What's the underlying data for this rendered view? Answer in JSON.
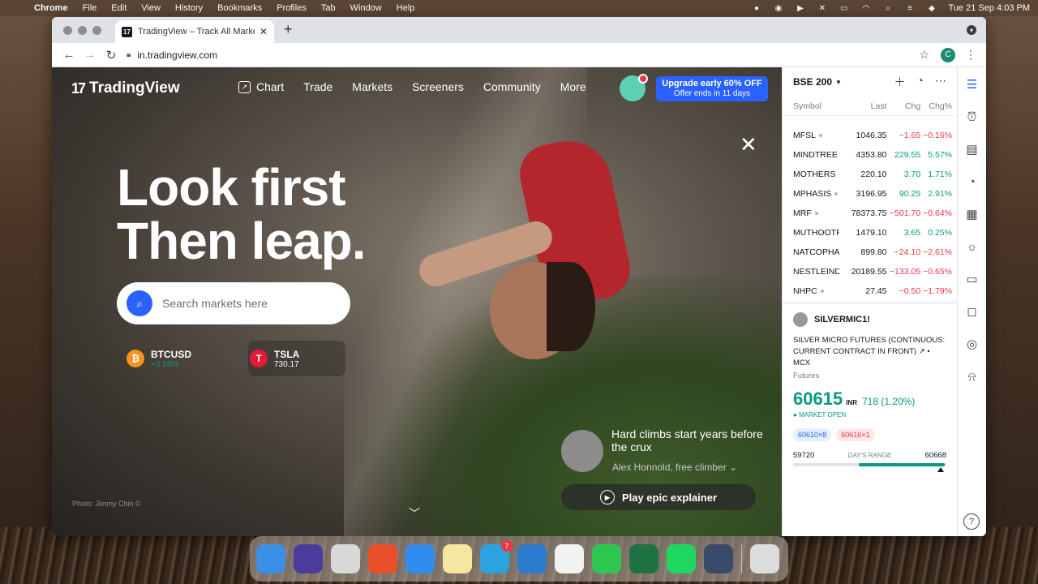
{
  "menubar": {
    "app": "Chrome",
    "items": [
      "File",
      "Edit",
      "View",
      "History",
      "Bookmarks",
      "Profiles",
      "Tab",
      "Window",
      "Help"
    ],
    "datetime": "Tue 21 Sep  4:03 PM",
    "notification_badge": "7"
  },
  "browser": {
    "tab_title": "TradingView – Track All Markets",
    "tab_favicon": "17",
    "url": "in.tradingview.com",
    "profile_initial": "C"
  },
  "tv": {
    "logo": "TradingView",
    "logo_mark": "17",
    "nav": [
      "Chart",
      "Trade",
      "Markets",
      "Screeners",
      "Community",
      "More"
    ],
    "upgrade_line1": "Upgrade early 60% OFF",
    "upgrade_line2": "Offer ends in 11 days",
    "headline_1": "Look first",
    "headline_2": "Then leap.",
    "search_placeholder": "Search markets here",
    "tickers": [
      {
        "name": "BTCUSD",
        "value": "+0.19%",
        "icon": "₿",
        "color": "#f7931a"
      },
      {
        "name": "TSLA",
        "value": "730.17",
        "icon": "T",
        "color": "#e31937"
      }
    ],
    "story_text": "Hard climbs start years before the crux",
    "story_author": "Alex Honnold, free climber",
    "play_label": "Play epic explainer",
    "photo_credit": "Photo: Jimmy Chin ©"
  },
  "watchlist": {
    "name": "BSE 200",
    "columns": [
      "Symbol",
      "Last",
      "Chg",
      "Chg%"
    ],
    "rows": [
      {
        "symbol": "MFSL",
        "last": "1046.35",
        "chg": "−1.65",
        "pct": "−0.16%",
        "dir": "down"
      },
      {
        "symbol": "MINDTREE",
        "last": "4353.80",
        "chg": "229.55",
        "pct": "5.57%",
        "dir": "up"
      },
      {
        "symbol": "MOTHERS",
        "last": "220.10",
        "chg": "3.70",
        "pct": "1.71%",
        "dir": "up"
      },
      {
        "symbol": "MPHASIS",
        "last": "3196.95",
        "chg": "90.25",
        "pct": "2.91%",
        "dir": "up"
      },
      {
        "symbol": "MRF",
        "last": "78373.75",
        "chg": "−501.70",
        "pct": "−0.64%",
        "dir": "down"
      },
      {
        "symbol": "MUTHOOTFIN",
        "last": "1479.10",
        "chg": "3.65",
        "pct": "0.25%",
        "dir": "up"
      },
      {
        "symbol": "NATCOPHARM",
        "last": "899.80",
        "chg": "−24.10",
        "pct": "−2.61%",
        "dir": "down"
      },
      {
        "symbol": "NESTLEIND",
        "last": "20189.55",
        "chg": "−133.05",
        "pct": "−0.65%",
        "dir": "down"
      },
      {
        "symbol": "NHPC",
        "last": "27.45",
        "chg": "−0.50",
        "pct": "−1.79%",
        "dir": "down"
      }
    ]
  },
  "detail": {
    "symbol": "SILVERMIC1!",
    "description": "SILVER MICRO FUTURES (CONTINUOUS: CURRENT CONTRACT IN FRONT)",
    "exchange": "MCX",
    "category": "Futures",
    "price": "60615",
    "currency": "INR",
    "change": "718 (1.20%)",
    "status": "MARKET OPEN",
    "bid": "60610×8",
    "ask": "60616×1",
    "range_low": "59720",
    "range_label": "DAY'S RANGE",
    "range_high": "60668",
    "range_position": 0.99
  },
  "dock_apps": [
    {
      "name": "finder",
      "color": "#3a8ee6"
    },
    {
      "name": "siri",
      "color": "#4b3c9c"
    },
    {
      "name": "launchpad",
      "color": "#d8d8d8"
    },
    {
      "name": "brave",
      "color": "#e94f2a"
    },
    {
      "name": "safari",
      "color": "#2f8df0"
    },
    {
      "name": "notes",
      "color": "#f4e8a0"
    },
    {
      "name": "telegram",
      "color": "#2ba3df",
      "badge": "7"
    },
    {
      "name": "edge",
      "color": "#2c7bcf"
    },
    {
      "name": "chrome",
      "color": "#f2f2f2"
    },
    {
      "name": "whatsapp",
      "color": "#2fc64f"
    },
    {
      "name": "excel",
      "color": "#1f7244"
    },
    {
      "name": "spotify",
      "color": "#1ed760"
    },
    {
      "name": "quicktime",
      "color": "#3a4a6a"
    },
    {
      "name": "trash",
      "color": "#dcdcdc"
    }
  ]
}
